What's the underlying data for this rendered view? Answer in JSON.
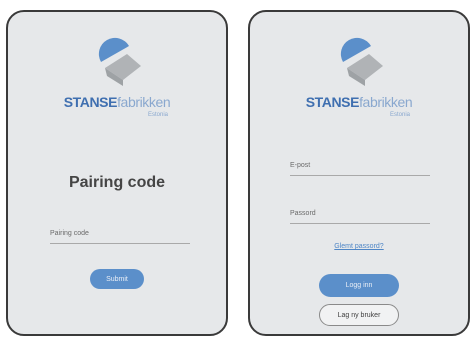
{
  "brand": {
    "name_bold": "STANSE",
    "name_light": "fabrikken",
    "tagline": "Estonia",
    "colors": {
      "blue_primary": "#3f6fb0",
      "blue_light": "#8aa8cf",
      "gray_mark": "#b0b3b6",
      "button": "#5b8fca",
      "link": "#4f86c6",
      "screen_bg": "#e6e8ea"
    }
  },
  "pairing_screen": {
    "title": "Pairing code",
    "input_placeholder": "Pairing code",
    "submit_label": "Submit"
  },
  "login_screen": {
    "email_placeholder": "E-post",
    "password_placeholder": "Passord",
    "forgot_label": "Glemt passord?",
    "login_label": "Logg inn",
    "switch_user_label": "Lag ny bruker"
  }
}
